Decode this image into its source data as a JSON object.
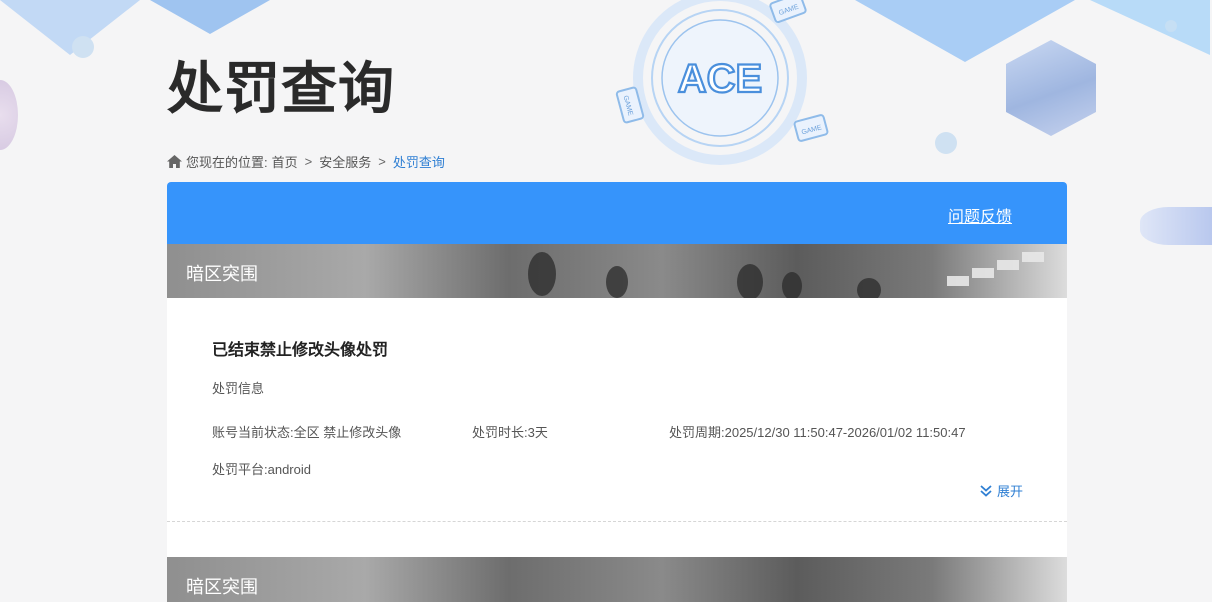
{
  "page": {
    "title": "处罚查询"
  },
  "breadcrumb": {
    "prefix": "您现在的位置:",
    "items": [
      "首页",
      "安全服务",
      "处罚查询"
    ],
    "separator": ">"
  },
  "panel": {
    "feedback_label": "问题反馈",
    "accent_color": "#3694fb"
  },
  "game": {
    "name": "暗区突围"
  },
  "record": {
    "title": "已结束禁止修改头像处罚",
    "info_label": "处罚信息",
    "status": "账号当前状态:全区 禁止修改头像",
    "duration": "处罚时长:3天",
    "period": "处罚周期:2025/12/30 11:50:47-2026/01/02 11:50:47",
    "platform": "处罚平台:android",
    "expand_label": "展开"
  },
  "emblem": {
    "logo_text": "ACE",
    "badge_text": "GAME"
  }
}
